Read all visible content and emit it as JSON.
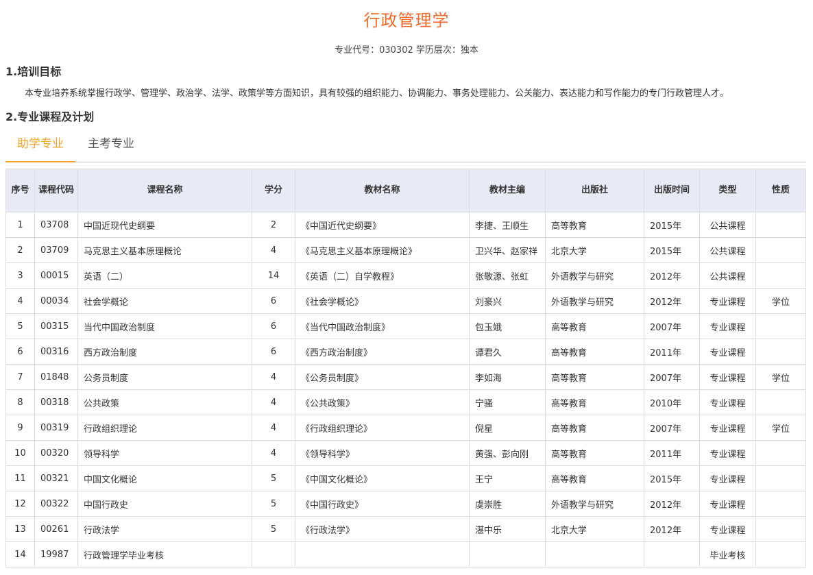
{
  "page": {
    "title": "行政管理学",
    "meta": "专业代号：030302 学历层次：独本"
  },
  "section1": {
    "heading": "1.培训目标",
    "text": "本专业培养系统掌握行政学、管理学、政治学、法学、政策学等方面知识，具有较强的组织能力、协调能力、事务处理能力、公关能力、表达能力和写作能力的专门行政管理人才。"
  },
  "section2": {
    "heading": "2.专业课程及计划"
  },
  "tabs": [
    {
      "label": "助学专业",
      "active": true
    },
    {
      "label": "主考专业",
      "active": false
    }
  ],
  "colors": {
    "accent": "#f5a32a",
    "title": "#f06a2a",
    "header_bg": "#e8eaf5"
  },
  "table": {
    "headers": [
      "序号",
      "课程代码",
      "课程名称",
      "学分",
      "教材名称",
      "教材主编",
      "出版社",
      "出版时间",
      "类型",
      "性质"
    ],
    "rows": [
      [
        "1",
        "03708",
        "中国近现代史纲要",
        "2",
        "《中国近代史纲要》",
        "李捷、王顺生",
        "高等教育",
        "2015年",
        "公共课程",
        ""
      ],
      [
        "2",
        "03709",
        "马克思主义基本原理概论",
        "4",
        "《马克思主义基本原理概论》",
        "卫兴华、赵家祥",
        "北京大学",
        "2015年",
        "公共课程",
        ""
      ],
      [
        "3",
        "00015",
        "英语（二）",
        "14",
        "《英语（二）自学教程》",
        "张敬源、张虹",
        "外语教学与研究",
        "2012年",
        "公共课程",
        ""
      ],
      [
        "4",
        "00034",
        "社会学概论",
        "6",
        "《社会学概论》",
        "刘豪兴",
        "外语教学与研究",
        "2012年",
        "专业课程",
        "学位"
      ],
      [
        "5",
        "00315",
        "当代中国政治制度",
        "6",
        "《当代中国政治制度》",
        "包玉娥",
        "高等教育",
        "2007年",
        "专业课程",
        ""
      ],
      [
        "6",
        "00316",
        "西方政治制度",
        "6",
        "《西方政治制度》",
        "谭君久",
        "高等教育",
        "2011年",
        "专业课程",
        ""
      ],
      [
        "7",
        "01848",
        "公务员制度",
        "4",
        "《公务员制度》",
        "李如海",
        "高等教育",
        "2007年",
        "专业课程",
        "学位"
      ],
      [
        "8",
        "00318",
        "公共政策",
        "4",
        "《公共政策》",
        "宁骚",
        "高等教育",
        "2010年",
        "专业课程",
        ""
      ],
      [
        "9",
        "00319",
        "行政组织理论",
        "4",
        "《行政组织理论》",
        "倪星",
        "高等教育",
        "2007年",
        "专业课程",
        "学位"
      ],
      [
        "10",
        "00320",
        "领导科学",
        "4",
        "《领导科学》",
        "黄强、彭向刚",
        "高等教育",
        "2011年",
        "专业课程",
        ""
      ],
      [
        "11",
        "00321",
        "中国文化概论",
        "5",
        "《中国文化概论》",
        "王宁",
        "高等教育",
        "2015年",
        "专业课程",
        ""
      ],
      [
        "12",
        "00322",
        "中国行政史",
        "5",
        "《中国行政史》",
        "虞崇胜",
        "外语教学与研究",
        "2012年",
        "专业课程",
        ""
      ],
      [
        "13",
        "00261",
        "行政法学",
        "5",
        "《行政法学》",
        "湛中乐",
        "北京大学",
        "2012年",
        "专业课程",
        ""
      ],
      [
        "14",
        "19987",
        "行政管理学毕业考核",
        "",
        "",
        "",
        "",
        "",
        "毕业考核",
        ""
      ]
    ]
  }
}
